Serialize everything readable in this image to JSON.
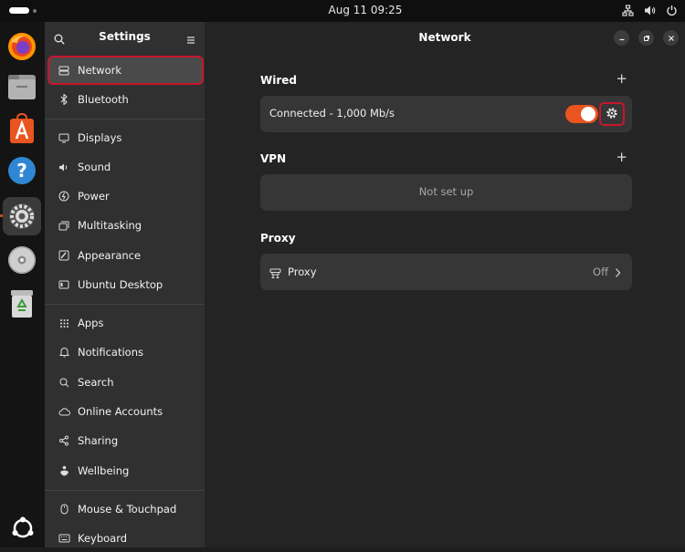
{
  "topbar": {
    "clock": "Aug 11  09:25"
  },
  "dock": {
    "items": [
      {
        "name": "firefox-icon"
      },
      {
        "name": "files-icon"
      },
      {
        "name": "app-center-icon"
      },
      {
        "name": "help-icon"
      },
      {
        "name": "settings-icon"
      },
      {
        "name": "disc-icon"
      },
      {
        "name": "trash-icon"
      }
    ]
  },
  "sidebar": {
    "title": "Settings",
    "items": [
      {
        "label": "Network",
        "icon": "network-icon"
      },
      {
        "label": "Bluetooth",
        "icon": "bluetooth-icon"
      },
      {
        "label": "Displays",
        "icon": "display-icon"
      },
      {
        "label": "Sound",
        "icon": "speaker-icon"
      },
      {
        "label": "Power",
        "icon": "power-icon"
      },
      {
        "label": "Multitasking",
        "icon": "multitasking-icon"
      },
      {
        "label": "Appearance",
        "icon": "appearance-icon"
      },
      {
        "label": "Ubuntu Desktop",
        "icon": "desktop-icon"
      },
      {
        "label": "Apps",
        "icon": "apps-grid-icon"
      },
      {
        "label": "Notifications",
        "icon": "bell-icon"
      },
      {
        "label": "Search",
        "icon": "search-icon"
      },
      {
        "label": "Online Accounts",
        "icon": "cloud-icon"
      },
      {
        "label": "Sharing",
        "icon": "share-icon"
      },
      {
        "label": "Wellbeing",
        "icon": "wellbeing-icon"
      },
      {
        "label": "Mouse & Touchpad",
        "icon": "mouse-icon"
      },
      {
        "label": "Keyboard",
        "icon": "keyboard-icon"
      }
    ]
  },
  "main": {
    "title": "Network",
    "wired": {
      "heading": "Wired",
      "add": "+",
      "status": "Connected - 1,000 Mb/s",
      "enabled": true
    },
    "vpn": {
      "heading": "VPN",
      "add": "+",
      "empty": "Not set up"
    },
    "proxy": {
      "heading": "Proxy",
      "label": "Proxy",
      "value": "Off"
    }
  },
  "colors": {
    "accent": "#e95420",
    "highlight": "#c7162b",
    "sidebar": "#303030",
    "main": "#242424",
    "card": "#363636"
  }
}
